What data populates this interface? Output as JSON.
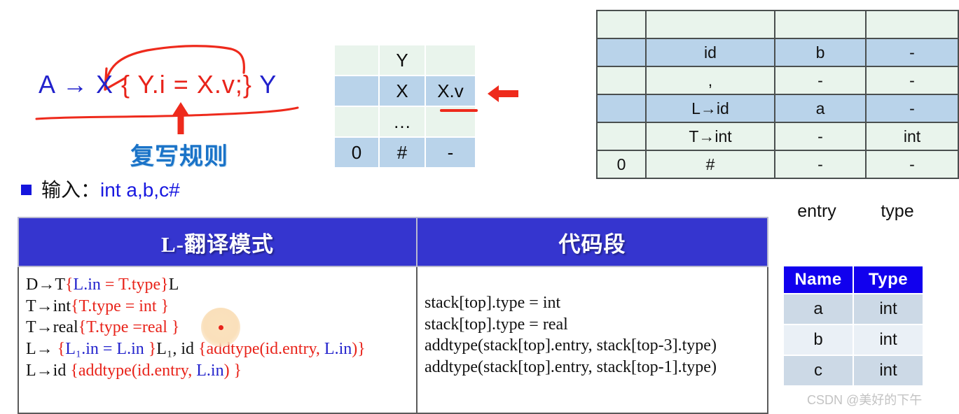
{
  "slide": {
    "formula": {
      "prefix": "A → X ",
      "action": "{ Y.i  = X.v;}",
      "suffix": " Y",
      "annotation_label": "复写规则",
      "blue_color": "#2222cc",
      "red_color": "#e8231a",
      "annotation_color": "#1a73c8"
    },
    "input_line": {
      "label": "输入：",
      "value": "int a,b,c#",
      "bullet_color": "#1515dd"
    }
  },
  "stack_table": {
    "row_blue_color": "#b9d3ea",
    "row_light_color": "#e9f4ec",
    "rows": [
      {
        "style": "light",
        "cells": [
          "",
          "Y",
          ""
        ]
      },
      {
        "style": "blue",
        "cells": [
          "",
          "X",
          "X.v"
        ]
      },
      {
        "style": "light",
        "cells": [
          "",
          "…",
          ""
        ]
      },
      {
        "style": "blue",
        "cells": [
          "0",
          "#",
          "-"
        ]
      }
    ],
    "pointer_icon": "left-arrow-icon",
    "pointer_color": "#ee2a1c"
  },
  "parse_table": {
    "rows": [
      {
        "style": "light",
        "cells": [
          "",
          "",
          "",
          ""
        ]
      },
      {
        "style": "blue",
        "cells": [
          "",
          "id",
          "b",
          "-"
        ]
      },
      {
        "style": "light",
        "cells": [
          "",
          ",",
          "-",
          "-"
        ]
      },
      {
        "style": "blue",
        "cells": [
          "",
          "L→id",
          "a",
          "-"
        ]
      },
      {
        "style": "light",
        "cells": [
          "",
          "T→int",
          "-",
          "int"
        ]
      },
      {
        "style": "light",
        "cells": [
          "0",
          "#",
          "-",
          "-"
        ]
      }
    ],
    "footer_labels": [
      "entry",
      "type"
    ]
  },
  "rules_table": {
    "headers": [
      "L-翻译模式",
      "代码段"
    ],
    "header_bg": "#3535cf",
    "translation_rules": [
      [
        {
          "t": "D→T",
          "c": "k"
        },
        {
          "t": "{",
          "c": "r"
        },
        {
          "t": "L.in",
          "c": "b"
        },
        {
          "t": " = ",
          "c": "r"
        },
        {
          "t": "T.type",
          "c": "r"
        },
        {
          "t": "}",
          "c": "r"
        },
        {
          "t": "L",
          "c": "k"
        }
      ],
      [
        {
          "t": "T→int",
          "c": "k"
        },
        {
          "t": "{",
          "c": "r"
        },
        {
          "t": "T.type = int }",
          "c": "r"
        }
      ],
      [
        {
          "t": "T→real",
          "c": "k"
        },
        {
          "t": "{",
          "c": "r"
        },
        {
          "t": "T.type =real }",
          "c": "r"
        }
      ],
      [
        {
          "t": "L→ ",
          "c": "k"
        },
        {
          "t": "{",
          "c": "r"
        },
        {
          "t": "L₁.in = L.in ",
          "c": "b"
        },
        {
          "t": "}",
          "c": "r"
        },
        {
          "t": "L₁",
          "c": "k"
        },
        {
          "t": ", id ",
          "c": "k"
        },
        {
          "t": "{addtype(id.entry, ",
          "c": "r"
        },
        {
          "t": "L.in",
          "c": "b"
        },
        {
          "t": ")}",
          "c": "r"
        }
      ],
      [
        {
          "t": "L→id ",
          "c": "k"
        },
        {
          "t": "{addtype(id.entry, ",
          "c": "r"
        },
        {
          "t": "L.in",
          "c": "b"
        },
        {
          "t": ") }",
          "c": "r"
        }
      ]
    ],
    "code_lines": [
      "stack[top].type = int",
      "stack[top].type = real",
      "addtype(stack[top].entry, stack[top-3].type)",
      "addtype(stack[top].entry, stack[top-1].type)"
    ]
  },
  "symbol_table": {
    "headers": [
      "Name",
      "Type"
    ],
    "header_bg": "#1100ee",
    "rows": [
      [
        "a",
        "int"
      ],
      [
        "b",
        "int"
      ],
      [
        "c",
        "int"
      ]
    ]
  },
  "watermark": "CSDN @美好的下午"
}
